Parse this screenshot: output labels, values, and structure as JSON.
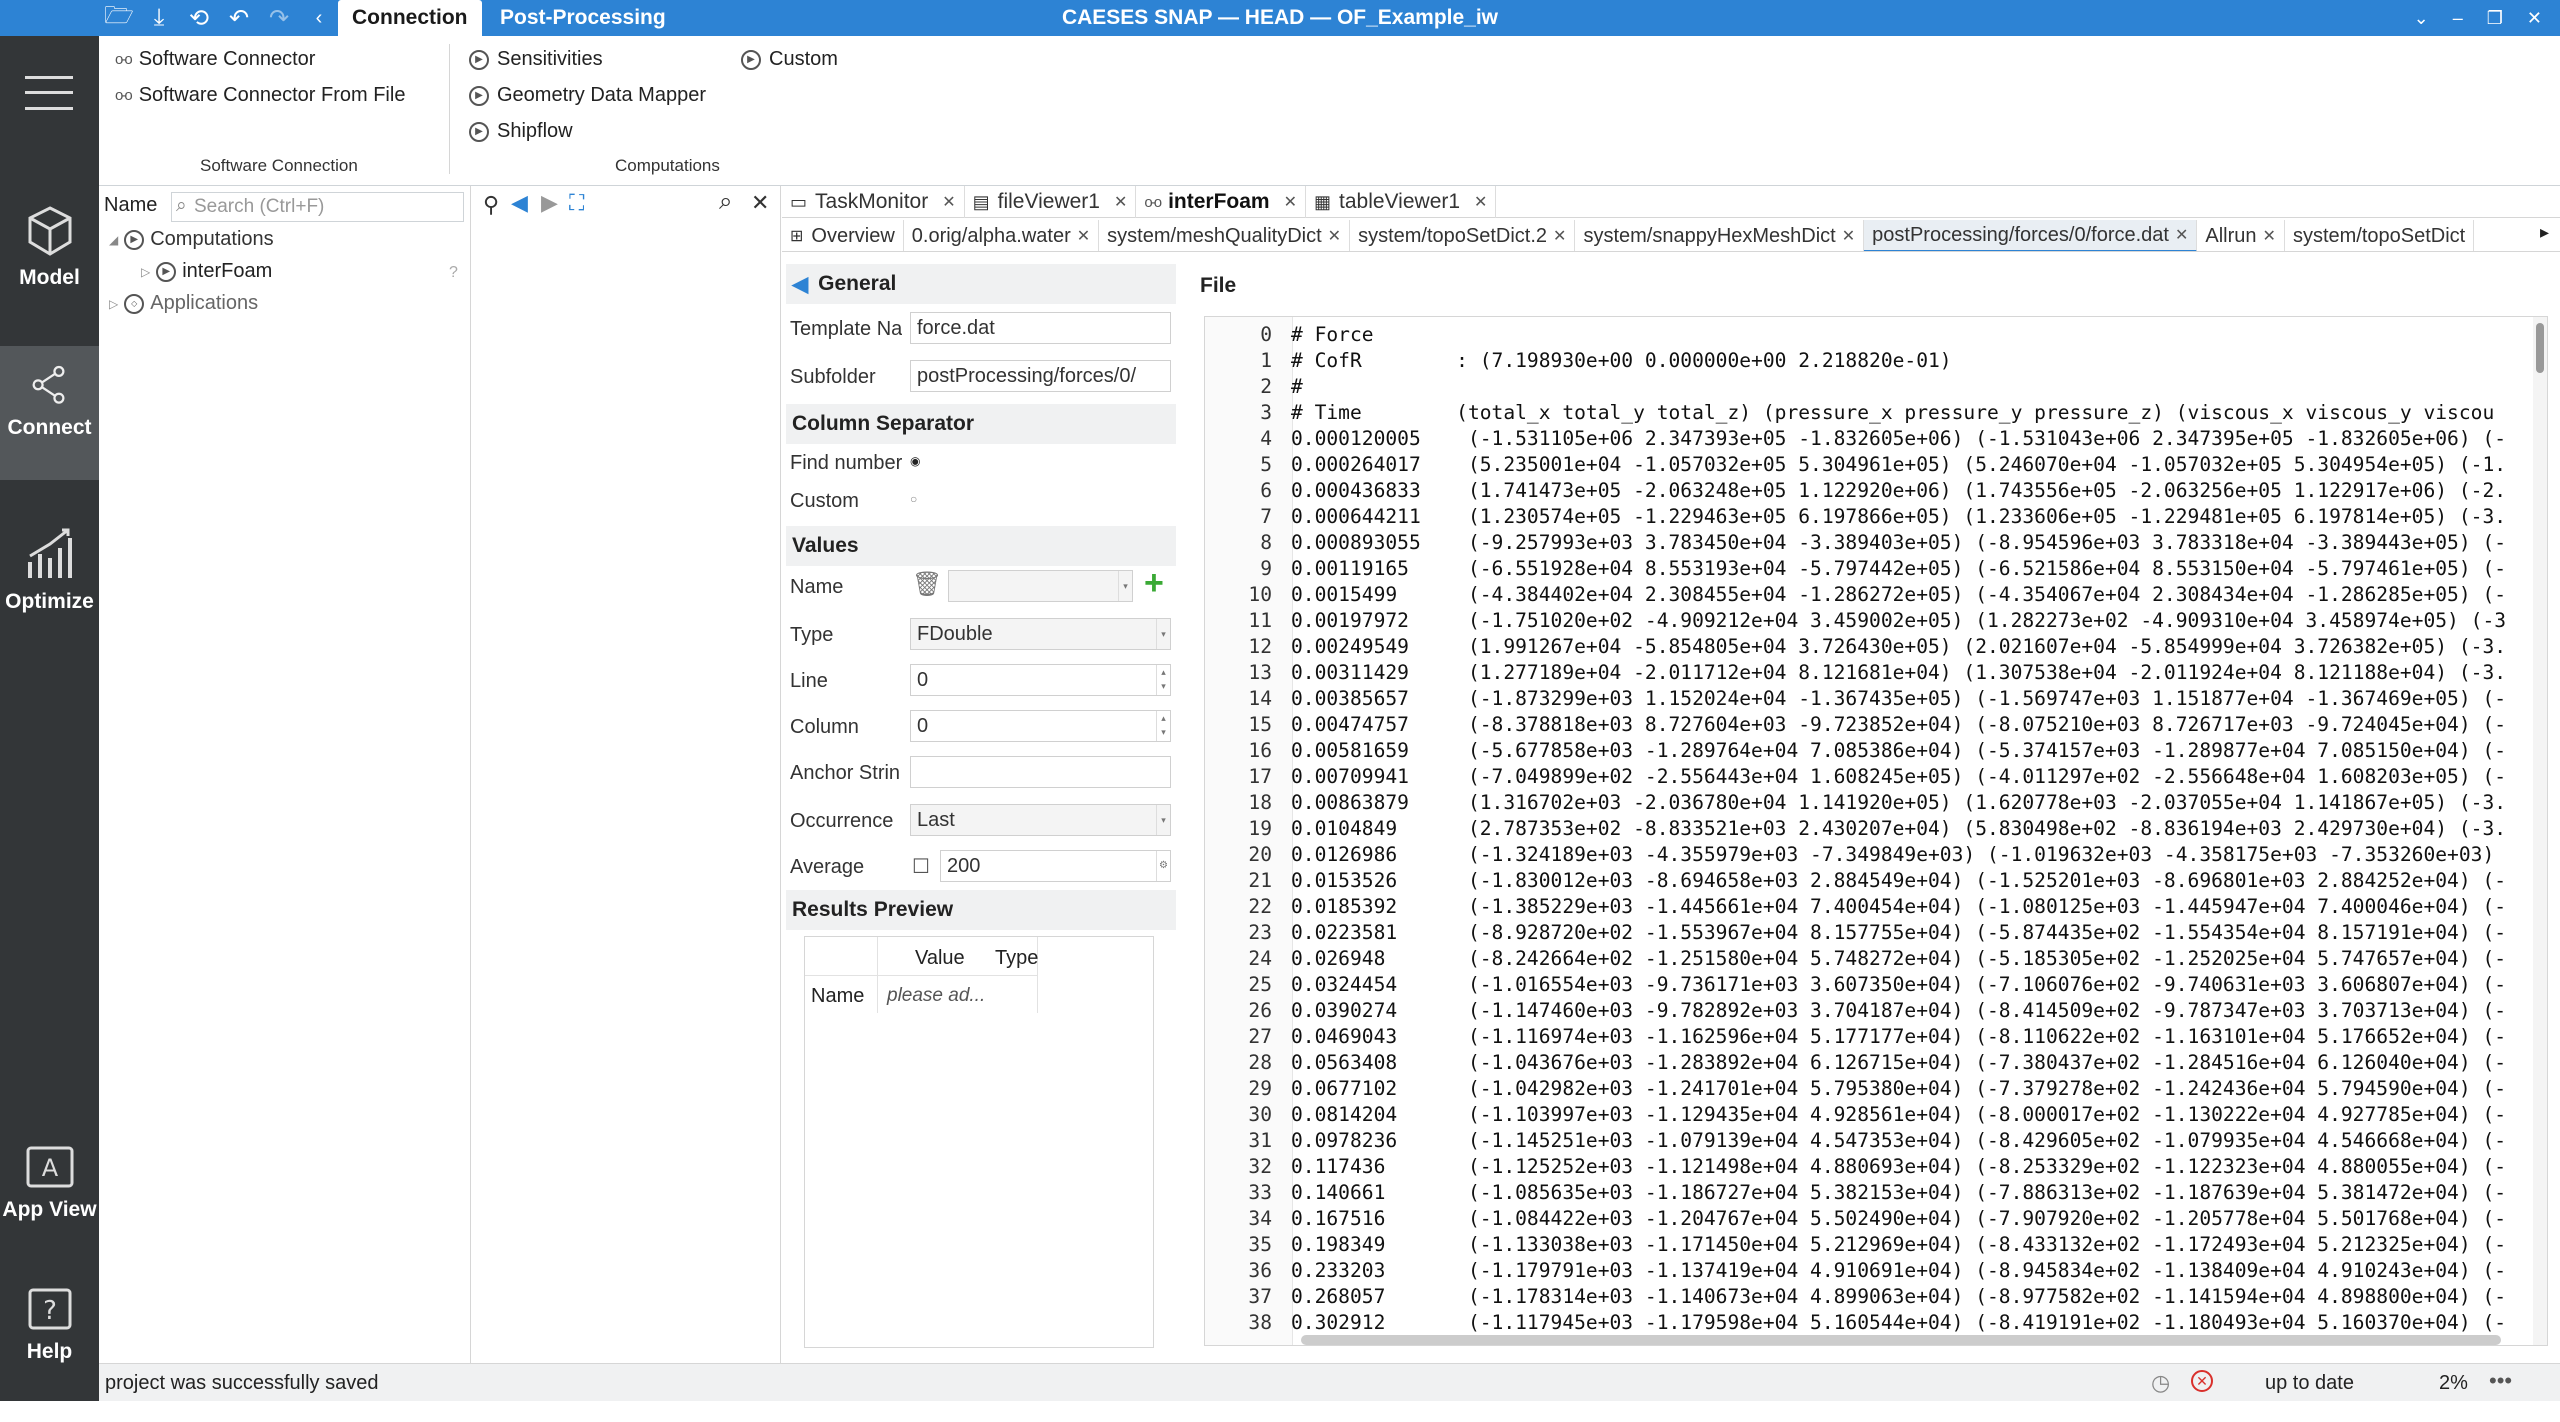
{
  "window": {
    "title": "CAESES SNAP — HEAD — OF_Example_iw"
  },
  "ribbon_tabs": [
    "Connection",
    "Post-Processing"
  ],
  "left_bar": {
    "items": [
      "Model",
      "Connect",
      "Optimize",
      "App View",
      "Help"
    ]
  },
  "ribbon": {
    "software_connector": "Software Connector",
    "software_connector_file": "Software Connector From File",
    "group_software": "Software Connection",
    "sensitivities": "Sensitivities",
    "geometry_mapper": "Geometry Data Mapper",
    "shipflow": "Shipflow",
    "custom": "Custom",
    "group_computations": "Computations"
  },
  "tree": {
    "name_label": "Name",
    "search_placeholder": "Search (Ctrl+F)",
    "items": [
      "Computations",
      "interFoam",
      "Applications"
    ]
  },
  "tabs_top": [
    "TaskMonitor",
    "fileViewer1",
    "interFoam",
    "tableViewer1"
  ],
  "tabs_files": [
    "Overview",
    "0.orig/alpha.water",
    "system/meshQualityDict",
    "system/topoSetDict.2",
    "system/snappyHexMeshDict",
    "postProcessing/forces/0/force.dat",
    "Allrun",
    "system/topoSetDict"
  ],
  "form": {
    "general": "General",
    "template_label": "Template Na",
    "template_value": "force.dat",
    "subfolder_label": "Subfolder",
    "subfolder_value": "postProcessing/forces/0/",
    "column_sep": "Column Separator",
    "find_number": "Find number",
    "custom": "Custom",
    "values": "Values",
    "name_label": "Name",
    "type_label": "Type",
    "type_value": "FDouble",
    "line_label": "Line",
    "line_value": "0",
    "column_label": "Column",
    "column_value": "0",
    "anchor_label": "Anchor Strin",
    "occurrence_label": "Occurrence",
    "occurrence_value": "Last",
    "average_label": "Average",
    "average_value": "200",
    "results_preview": "Results Preview",
    "col_value": "Value",
    "col_type": "Type",
    "row_name": "Name",
    "row_placeholder": "please ad..."
  },
  "file_title": "File",
  "file_lines": [
    "# Force",
    "# CofR        : (7.198930e+00 0.000000e+00 2.218820e-01)",
    "#",
    "# Time        (total_x total_y total_z) (pressure_x pressure_y pressure_z) (viscous_x viscous_y viscou",
    "0.000120005    (-1.531105e+06 2.347393e+05 -1.832605e+06) (-1.531043e+06 2.347395e+05 -1.832605e+06) (-",
    "0.000264017    (5.235001e+04 -1.057032e+05 5.304961e+05) (5.246070e+04 -1.057032e+05 5.304954e+05) (-1.",
    "0.000436833    (1.741473e+05 -2.063248e+05 1.122920e+06) (1.743556e+05 -2.063256e+05 1.122917e+06) (-2.",
    "0.000644211    (1.230574e+05 -1.229463e+05 6.197866e+05) (1.233606e+05 -1.229481e+05 6.197814e+05) (-3.",
    "0.000893055    (-9.257993e+03 3.783450e+04 -3.389403e+05) (-8.954596e+03 3.783318e+04 -3.389443e+05) (-",
    "0.00119165     (-6.551928e+04 8.553193e+04 -5.797442e+05) (-6.521586e+04 8.553150e+04 -5.797461e+05) (-",
    "0.0015499      (-4.384402e+04 2.308455e+04 -1.286272e+05) (-4.354067e+04 2.308434e+04 -1.286285e+05) (-",
    "0.00197972     (-1.751020e+02 -4.909212e+04 3.459002e+05) (1.282273e+02 -4.909310e+04 3.458974e+05) (-3",
    "0.00249549     (1.991267e+04 -5.854805e+04 3.726430e+05) (2.021607e+04 -5.854999e+04 3.726382e+05) (-3.",
    "0.00311429     (1.277189e+04 -2.011712e+04 8.121681e+04) (1.307538e+04 -2.011924e+04 8.121188e+04) (-3.",
    "0.00385657     (-1.873299e+03 1.152024e+04 -1.367435e+05) (-1.569747e+03 1.151877e+04 -1.367469e+05) (-",
    "0.00474757     (-8.378818e+03 8.727604e+03 -9.723852e+04) (-8.075210e+03 8.726717e+03 -9.724045e+04) (-",
    "0.00581659     (-5.677858e+03 -1.289764e+04 7.085386e+04) (-5.374157e+03 -1.289877e+04 7.085150e+04) (-",
    "0.00709941     (-7.049899e+02 -2.556443e+04 1.608245e+05) (-4.011297e+02 -2.556648e+04 1.608203e+05) (-",
    "0.00863879     (1.316702e+03 -2.036780e+04 1.141920e+05) (1.620778e+03 -2.037055e+04 1.141867e+05) (-3.",
    "0.0104849      (2.787353e+02 -8.833521e+03 2.430207e+04) (5.830498e+02 -8.836194e+03 2.429730e+04) (-3.",
    "0.0126986      (-1.324189e+03 -4.355979e+03 -7.349849e+03) (-1.019632e+03 -4.358175e+03 -7.353260e+03)",
    "0.0153526      (-1.830012e+03 -8.694658e+03 2.884549e+04) (-1.525201e+03 -8.696801e+03 2.884252e+04) (-",
    "0.0185392      (-1.385229e+03 -1.445661e+04 7.400454e+04) (-1.080125e+03 -1.445947e+04 7.400046e+04) (-",
    "0.0223581      (-8.928720e+02 -1.553967e+04 8.157755e+04) (-5.874435e+02 -1.554354e+04 8.157191e+04) (-",
    "0.026948       (-8.242664e+02 -1.251580e+04 5.748272e+04) (-5.185305e+02 -1.252025e+04 5.747657e+04) (-",
    "0.0324454      (-1.016554e+03 -9.736171e+03 3.607350e+04) (-7.106076e+02 -9.740631e+03 3.606807e+04) (-",
    "0.0390274      (-1.147460e+03 -9.782892e+03 3.704187e+04) (-8.414509e+02 -9.787347e+03 3.703713e+04) (-",
    "0.0469043      (-1.116974e+03 -1.162596e+04 5.177177e+04) (-8.110622e+02 -1.163101e+04 5.176652e+04) (-",
    "0.0563408      (-1.043676e+03 -1.283892e+04 6.126715e+04) (-7.380437e+02 -1.284516e+04 6.126040e+04) (-",
    "0.0677102      (-1.042982e+03 -1.241701e+04 5.795380e+04) (-7.379278e+02 -1.242436e+04 5.794590e+04) (-",
    "0.0814204      (-1.103997e+03 -1.129435e+04 4.928561e+04) (-8.000017e+02 -1.130222e+04 4.927785e+04) (-",
    "0.0978236      (-1.145251e+03 -1.079139e+04 4.547353e+04) (-8.429605e+02 -1.079935e+04 4.546668e+04) (-",
    "0.117436       (-1.125252e+03 -1.121498e+04 4.880693e+04) (-8.253329e+02 -1.122323e+04 4.880055e+04) (-",
    "0.140661       (-1.085635e+03 -1.186727e+04 5.382153e+04) (-7.886313e+02 -1.187639e+04 5.381472e+04) (-",
    "0.167516       (-1.084422e+03 -1.204767e+04 5.502490e+04) (-7.907920e+02 -1.205778e+04 5.501768e+04) (-",
    "0.198349       (-1.133038e+03 -1.171450e+04 5.212969e+04) (-8.433132e+02 -1.172493e+04 5.212325e+04) (-",
    "0.233203       (-1.179791e+03 -1.137419e+04 4.910691e+04) (-8.945834e+02 -1.138409e+04 4.910243e+04) (-",
    "0.268057       (-1.178314e+03 -1.140673e+04 4.899063e+04) (-8.977582e+02 -1.141594e+04 4.898800e+04) (-",
    "0.302912       (-1.117945e+03 -1.179598e+04 5.160544e+04) (-8.419191e+02 -1.180493e+04 5.160370e+04) (-"
  ],
  "status": {
    "message": "project was successfully saved",
    "state": "up to date",
    "percent": "2%"
  },
  "colors": {
    "accent": "#2d83d4",
    "sidebar": "#333638",
    "add": "#3aa935",
    "error": "#d9302c"
  }
}
